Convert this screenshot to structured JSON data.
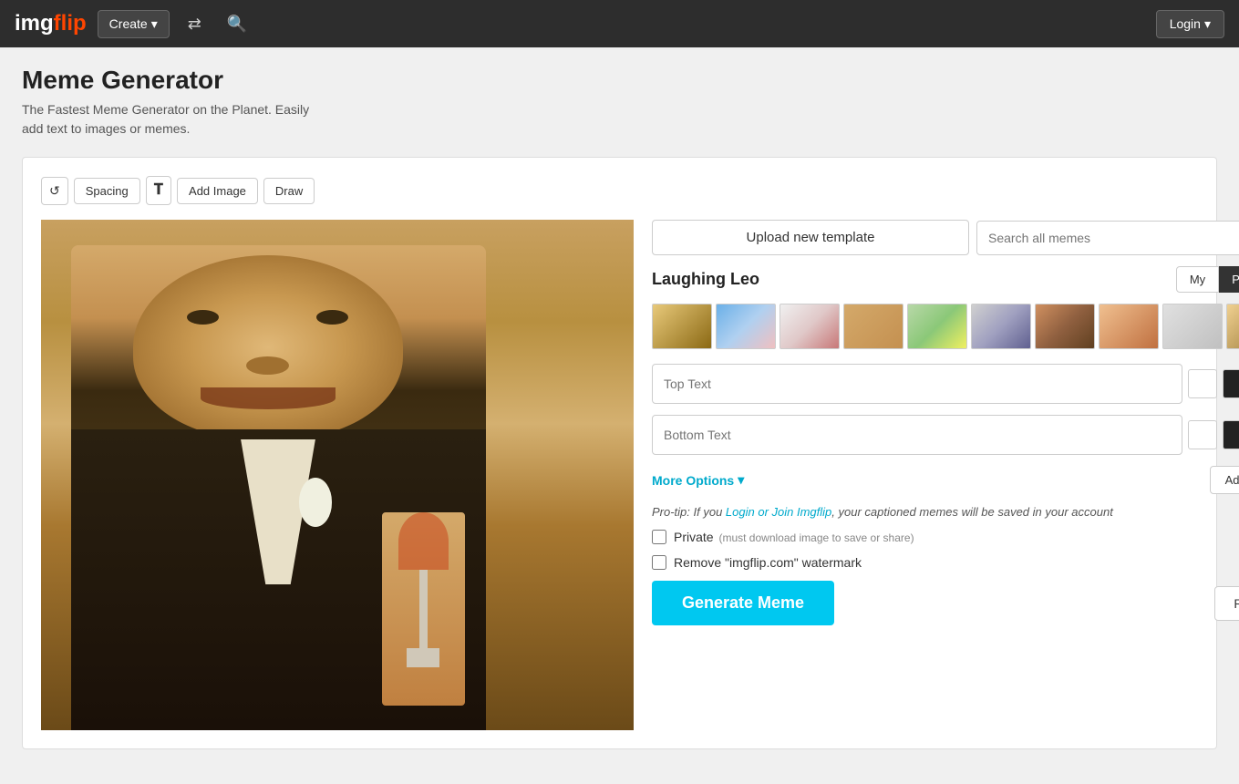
{
  "header": {
    "logo": "imgflip",
    "logo_color_part": "img",
    "logo_accent_part": "flip",
    "create_label": "Create",
    "create_dropdown_arrow": "▾",
    "login_label": "Login",
    "login_dropdown_arrow": "▾"
  },
  "page": {
    "title": "Meme Generator",
    "subtitle_line1": "The Fastest Meme Generator on the Planet. Easily",
    "subtitle_line2": "add text to images or memes."
  },
  "toolbar": {
    "reset_icon": "↺",
    "spacing_label": "Spacing",
    "font_icon": "𝐓",
    "add_image_label": "Add Image",
    "draw_label": "Draw"
  },
  "template_section": {
    "upload_label": "Upload new template",
    "search_placeholder": "Search all memes",
    "current_template": "Laughing Leo",
    "tab_my": "My",
    "tab_popular": "Popular"
  },
  "text_inputs": {
    "top_text_placeholder": "Top Text",
    "bottom_text_placeholder": "Bottom Text"
  },
  "options": {
    "more_options_label": "More Options",
    "more_options_arrow": "▾",
    "add_text_label": "Add Text",
    "pro_tip_text": "Pro-tip: If you ",
    "pro_tip_link": "Login or Join Imgflip",
    "pro_tip_suffix": ", your captioned memes will be saved in your account",
    "private_label": "Private",
    "private_note": "(must download image to save or share)",
    "watermark_label": "Remove \"imgflip.com\" watermark",
    "generate_label": "Generate Meme",
    "reset_label": "Reset"
  },
  "colors": {
    "accent": "#00c8f0",
    "header_bg": "#2d2d2d",
    "logo_red": "#ff4500",
    "more_options_color": "#00aacc",
    "link_color": "#00aacc"
  }
}
